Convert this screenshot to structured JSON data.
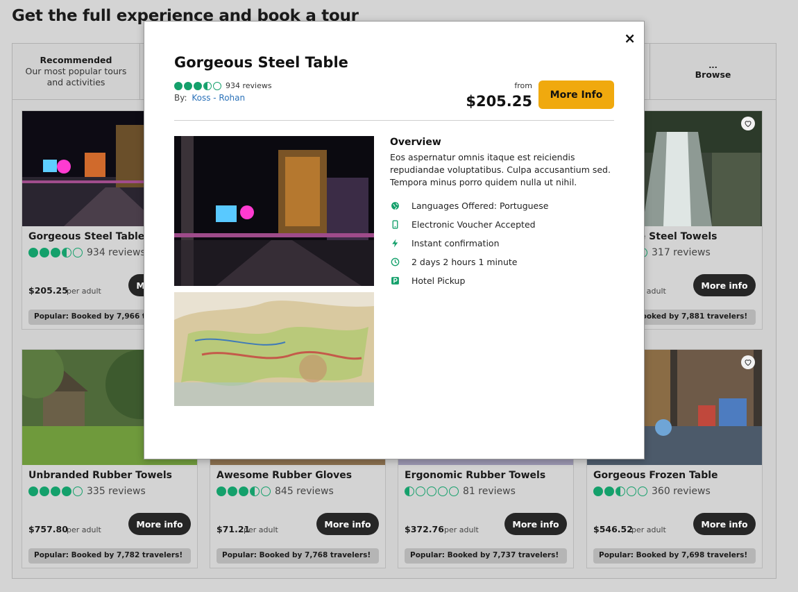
{
  "page": {
    "title": "Get the full experience and book a tour"
  },
  "tabs": [
    {
      "title": "Recommended",
      "subtitle": "Our most popular tours and activities"
    },
    {
      "title": "...",
      "subtitle": "Browse"
    }
  ],
  "cards": [
    {
      "name": "Gorgeous Steel Table",
      "rating": 3.5,
      "reviews": "934 reviews",
      "price": "$205.25",
      "per": "per adult",
      "more": "More info",
      "badge": "Popular: Booked by 7,966 travelers!"
    },
    {
      "name": "Awesome Steel Towels",
      "rating": 1.5,
      "reviews": "317 reviews",
      "price": "$…",
      "per": "per adult",
      "more": "More info",
      "badge": "Popular: Booked by 7,881 travelers!"
    },
    {
      "name": "Unbranded Rubber Towels",
      "rating": 4,
      "reviews": "335 reviews",
      "price": "$757.80",
      "per": "per adult",
      "more": "More info",
      "badge": "Popular: Booked by 7,782 travelers!"
    },
    {
      "name": "Awesome Rubber Gloves",
      "rating": 3.5,
      "reviews": "845 reviews",
      "price": "$71.21",
      "per": "per adult",
      "more": "More info",
      "badge": "Popular: Booked by 7,768 travelers!"
    },
    {
      "name": "Ergonomic Rubber Towels",
      "rating": 0.5,
      "reviews": "81 reviews",
      "price": "$372.76",
      "per": "per adult",
      "more": "More info",
      "badge": "Popular: Booked by 7,737 travelers!"
    },
    {
      "name": "Gorgeous Frozen Table",
      "rating": 2.5,
      "reviews": "360 reviews",
      "price": "$546.52",
      "per": "per adult",
      "more": "More info",
      "badge": "Popular: Booked by 7,698 travelers!"
    }
  ],
  "modal": {
    "close": "×",
    "title": "Gorgeous Steel Table",
    "rating": 3.5,
    "reviews": "934 reviews",
    "by_label": "By:",
    "by_link": "Koss - Rohan",
    "from": "from",
    "price": "$205.25",
    "more": "More Info",
    "overview_title": "Overview",
    "overview_text": "Eos aspernatur omnis itaque est reiciendis repudiandae voluptatibus. Culpa accusantium sed. Tempora minus porro quidem nulla ut nihil.",
    "features": [
      {
        "icon": "globe-icon",
        "text": "Languages Offered: Portuguese"
      },
      {
        "icon": "phone-icon",
        "text": "Electronic Voucher Accepted"
      },
      {
        "icon": "lightning-icon",
        "text": "Instant confirmation"
      },
      {
        "icon": "clock-icon",
        "text": "2 days 2 hours 1 minute"
      },
      {
        "icon": "parking-icon",
        "text": "Hotel Pickup"
      }
    ],
    "accent": "#f0a90e"
  },
  "colors": {
    "rating_green": "#14a06b",
    "button_dark": "#262626",
    "link_blue": "#2b72b9"
  }
}
